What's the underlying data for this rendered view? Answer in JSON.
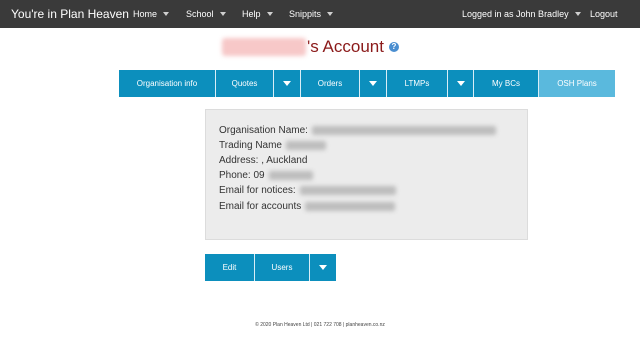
{
  "navbar": {
    "brand": "You're in Plan Heaven",
    "items": [
      {
        "label": "Home"
      },
      {
        "label": "School"
      },
      {
        "label": "Help"
      },
      {
        "label": "Snippits"
      }
    ],
    "user_label": "Logged in as John Bradley",
    "logout_label": "Logout"
  },
  "page": {
    "title_suffix": "'s Account",
    "help_glyph": "?"
  },
  "tabs": [
    {
      "label": "Organisation info"
    },
    {
      "label": "Quotes"
    },
    {
      "label": "Orders"
    },
    {
      "label": "LTMPs"
    },
    {
      "label": "My BCs"
    },
    {
      "label": "OSH Plans"
    }
  ],
  "org": {
    "name_label": "Organisation Name:",
    "trading_label": "Trading Name",
    "address_label": "Address: , Auckland",
    "phone_label": "Phone: 09",
    "notices_label": "Email for notices:",
    "accounts_label": "Email for accounts"
  },
  "actions": {
    "edit_label": "Edit",
    "users_label": "Users"
  },
  "footer": {
    "text": "© 2020 Plan Heaven Ltd | 021 722 708 | planheaven.co.nz"
  },
  "colors": {
    "navbar_bg": "#3a3a3a",
    "accent": "#0c8fbd",
    "active_tab": "#5ab9dd",
    "title": "#8b1a1a"
  }
}
